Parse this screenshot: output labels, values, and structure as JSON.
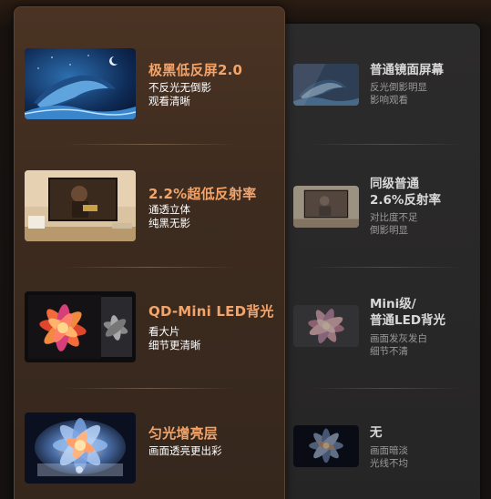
{
  "premium": {
    "rows": [
      {
        "title": "极黑低反屏2.0",
        "lines": [
          "不反光无倒影",
          "观看清晰"
        ],
        "icon": "whale-image"
      },
      {
        "title": "2.2%超低反射率",
        "lines": [
          "通透立体",
          "纯黑无影"
        ],
        "icon": "tv-living-room-image"
      },
      {
        "title": "QD-Mini LED背光",
        "lines": [
          "看大片",
          "细节更清晰"
        ],
        "icon": "flower-panels-image"
      },
      {
        "title": "匀光增亮层",
        "lines": [
          "画面透亮更出彩"
        ],
        "icon": "glowing-flower-image"
      }
    ]
  },
  "standard": {
    "rows": [
      {
        "title_lines": [
          "普通镜面屏幕"
        ],
        "lines": [
          "反光倒影明显",
          "影响观看"
        ]
      },
      {
        "title_lines": [
          "同级普通",
          "2.6%反射率"
        ],
        "lines": [
          "对比度不足",
          "倒影明显"
        ]
      },
      {
        "title_lines": [
          "Mini级/",
          "普通LED背光"
        ],
        "lines": [
          "画面发灰发白",
          "细节不清"
        ]
      },
      {
        "title_lines": [
          "无"
        ],
        "lines": [
          "画面暗淡",
          "光线不均"
        ]
      }
    ]
  },
  "colors": {
    "accent_title": "#f2a46b",
    "premium_card": "#3d2b1f",
    "standard_card": "#2a2929"
  }
}
